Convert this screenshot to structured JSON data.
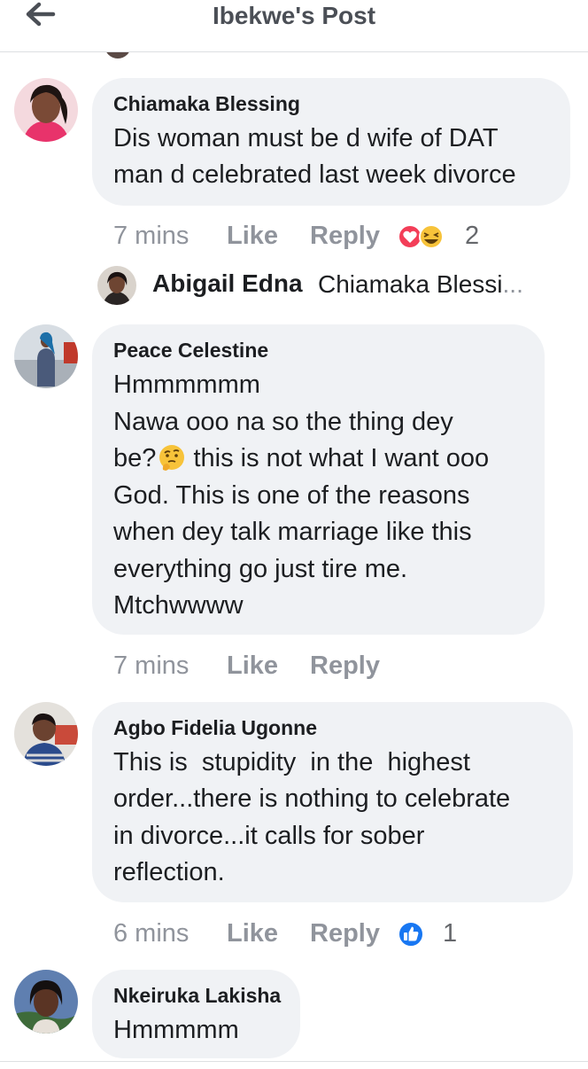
{
  "header": {
    "title": "Ibekwe's Post",
    "back_icon": "arrow-left-icon"
  },
  "comments": [
    {
      "author": "Chiamaka Blessing",
      "lines": [
        "Dis woman must be d wife of DAT",
        "man d celebrated last week divorce"
      ],
      "time": "7 mins",
      "like": "Like",
      "reply": "Reply",
      "reactions": [
        "love-icon",
        "laughing-emoji-icon"
      ],
      "reaction_count": "2"
    },
    {
      "author": "Peace Celestine",
      "lines": [
        "Hmmmmmm",
        "Nawa ooo na so the thing dey",
        "be?",
        " this is not what I want ooo",
        "God. This is one of the reasons",
        "when dey talk marriage like this",
        "everything go just tire me.",
        "Mtchwwww"
      ],
      "emoji": "thinking-face-icon",
      "time": "7 mins",
      "like": "Like",
      "reply": "Reply"
    },
    {
      "author": "Agbo Fidelia Ugonne",
      "lines": [
        "This is  stupidity  in the  highest",
        "order...there is nothing to celebrate",
        "in divorce...it calls for sober",
        "reflection."
      ],
      "time": "6 mins",
      "like": "Like",
      "reply": "Reply",
      "reactions": [
        "like-thumb-icon"
      ],
      "reaction_count": "1"
    },
    {
      "author": "Nkeiruka Lakisha",
      "lines": [
        "Hmmmmm"
      ]
    }
  ],
  "nested_reply": {
    "author": "Abigail Edna",
    "snippet": "Chiamaka Blessi",
    "ellipsis": "..."
  },
  "colors": {
    "bubble": "#f0f2f5",
    "meta_text": "#90949c",
    "love": "#f33e58",
    "like_blue": "#1877f2",
    "emoji_yellow": "#f7c33a"
  }
}
